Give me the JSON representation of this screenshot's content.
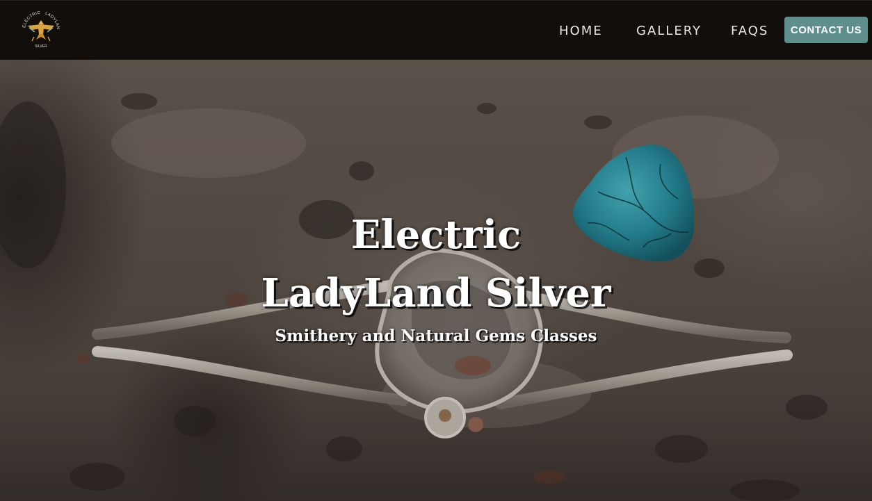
{
  "header": {
    "logo": {
      "icon": "thunderbird-logo-icon",
      "text_top_left": "ELECTRIC",
      "text_top_right": "LADYLAND",
      "text_bottom": "SILVER"
    },
    "nav": {
      "home": "HOME",
      "gallery": "GALLERY",
      "faqs": "FAQS"
    },
    "contact_button": "CONTACT US"
  },
  "hero": {
    "title_line1": "Electric",
    "title_line2": "LadyLand Silver",
    "subtitle": "Smithery and Natural Gems Classes",
    "image": "silver-bracelet-and-turquoise-on-stone-photo"
  },
  "colors": {
    "header_bg": "#120e0b",
    "nav_text": "#ece7e1",
    "button_bg": "#5e8f8c",
    "logo_gold": "#d9a441",
    "turquoise": "#2fa3b3"
  }
}
